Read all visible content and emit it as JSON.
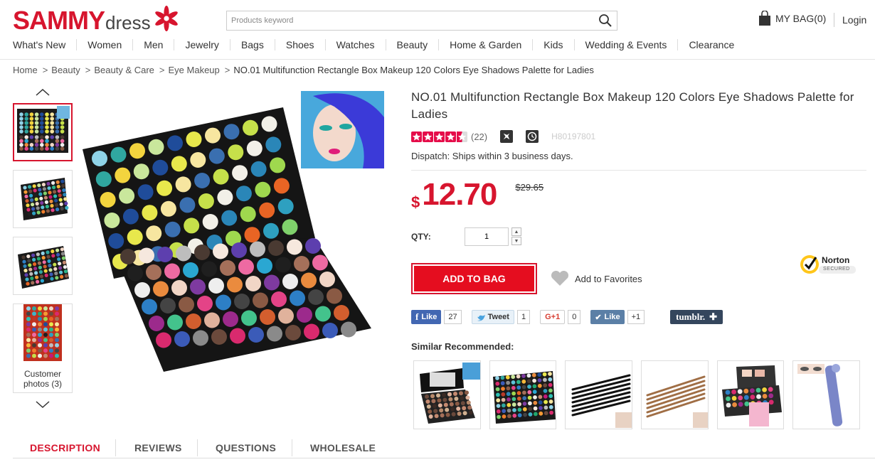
{
  "header": {
    "logo_main": "SAMMY",
    "logo_sub": "dress",
    "search_placeholder": "Products keyword",
    "bag_label": "MY BAG(0)",
    "login_label": "Login"
  },
  "nav": [
    "What's New",
    "Women",
    "Men",
    "Jewelry",
    "Bags",
    "Shoes",
    "Watches",
    "Beauty",
    "Home & Garden",
    "Kids",
    "Wedding & Events",
    "Clearance"
  ],
  "breadcrumb": [
    "Home",
    "Beauty",
    "Beauty & Care",
    "Eye Makeup",
    "NO.01 Multifunction Rectangle Box Makeup 120 Colors Eye Shadows Palette for Ladies"
  ],
  "gallery": {
    "customer_photos_label": "Customer photos (3)"
  },
  "product": {
    "title": "NO.01 Multifunction Rectangle Box Makeup 120 Colors Eye Shadows Palette for Ladies",
    "rating": 4.5,
    "rating_max": 5,
    "review_count": "(22)",
    "sku": "H80197801",
    "dispatch": "Dispatch: Ships within 3 business days.",
    "currency": "$",
    "price": "12.70",
    "old_price": "$29.65",
    "qty_label": "QTY:",
    "qty_value": "1",
    "add_to_bag": "ADD TO BAG",
    "add_to_favorites": "Add to Favorites",
    "norton_label": "Norton",
    "norton_sub": "SECURED"
  },
  "social": {
    "fb_label": "Like",
    "fb_count": "27",
    "tw_label": "Tweet",
    "tw_count": "1",
    "gp_label": "G+1",
    "gp_count": "0",
    "vk_label": "Like",
    "vk_count": "+1",
    "tumblr_label": "tumblr."
  },
  "similar": {
    "title": "Similar Recommended:"
  },
  "tabs": [
    "DESCRIPTION",
    "REVIEWS",
    "QUESTIONS",
    "WHOLESALE"
  ],
  "colors": {
    "brand": "#d7152e",
    "button": "#e50d1f"
  }
}
